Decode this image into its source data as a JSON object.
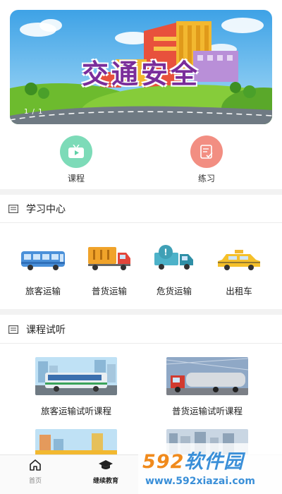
{
  "banner": {
    "title": "交通安全",
    "counter": "1 / 1"
  },
  "quick": [
    {
      "label": "课程",
      "icon": "tv-icon",
      "color": "#5fd0a6"
    },
    {
      "label": "练习",
      "icon": "checklist-icon",
      "color": "#f07a6e"
    }
  ],
  "study_center": {
    "title": "学习中心",
    "items": [
      {
        "label": "旅客运输",
        "icon": "bus-icon"
      },
      {
        "label": "普货运输",
        "icon": "cargo-truck-icon"
      },
      {
        "label": "危货运输",
        "icon": "hazard-truck-icon"
      },
      {
        "label": "出租车",
        "icon": "taxi-icon"
      }
    ]
  },
  "course_trial": {
    "title": "课程试听",
    "courses": [
      {
        "title": "旅客运输试听课程"
      },
      {
        "title": "普货运输试听课程"
      },
      {
        "title": ""
      },
      {
        "title": ""
      }
    ]
  },
  "tabbar": {
    "items": [
      {
        "label": "首页",
        "icon": "home-icon",
        "active": false
      },
      {
        "label": "继续教育",
        "icon": "graduation-cap-icon",
        "active": true
      }
    ]
  },
  "watermark": {
    "logo_part1": "592",
    "logo_part2": "软件园",
    "url": "www.592xiazai.com"
  },
  "colors": {
    "accent_green": "#5fd0a6",
    "accent_red": "#f07a6e",
    "divider": "#f2f2f2"
  }
}
